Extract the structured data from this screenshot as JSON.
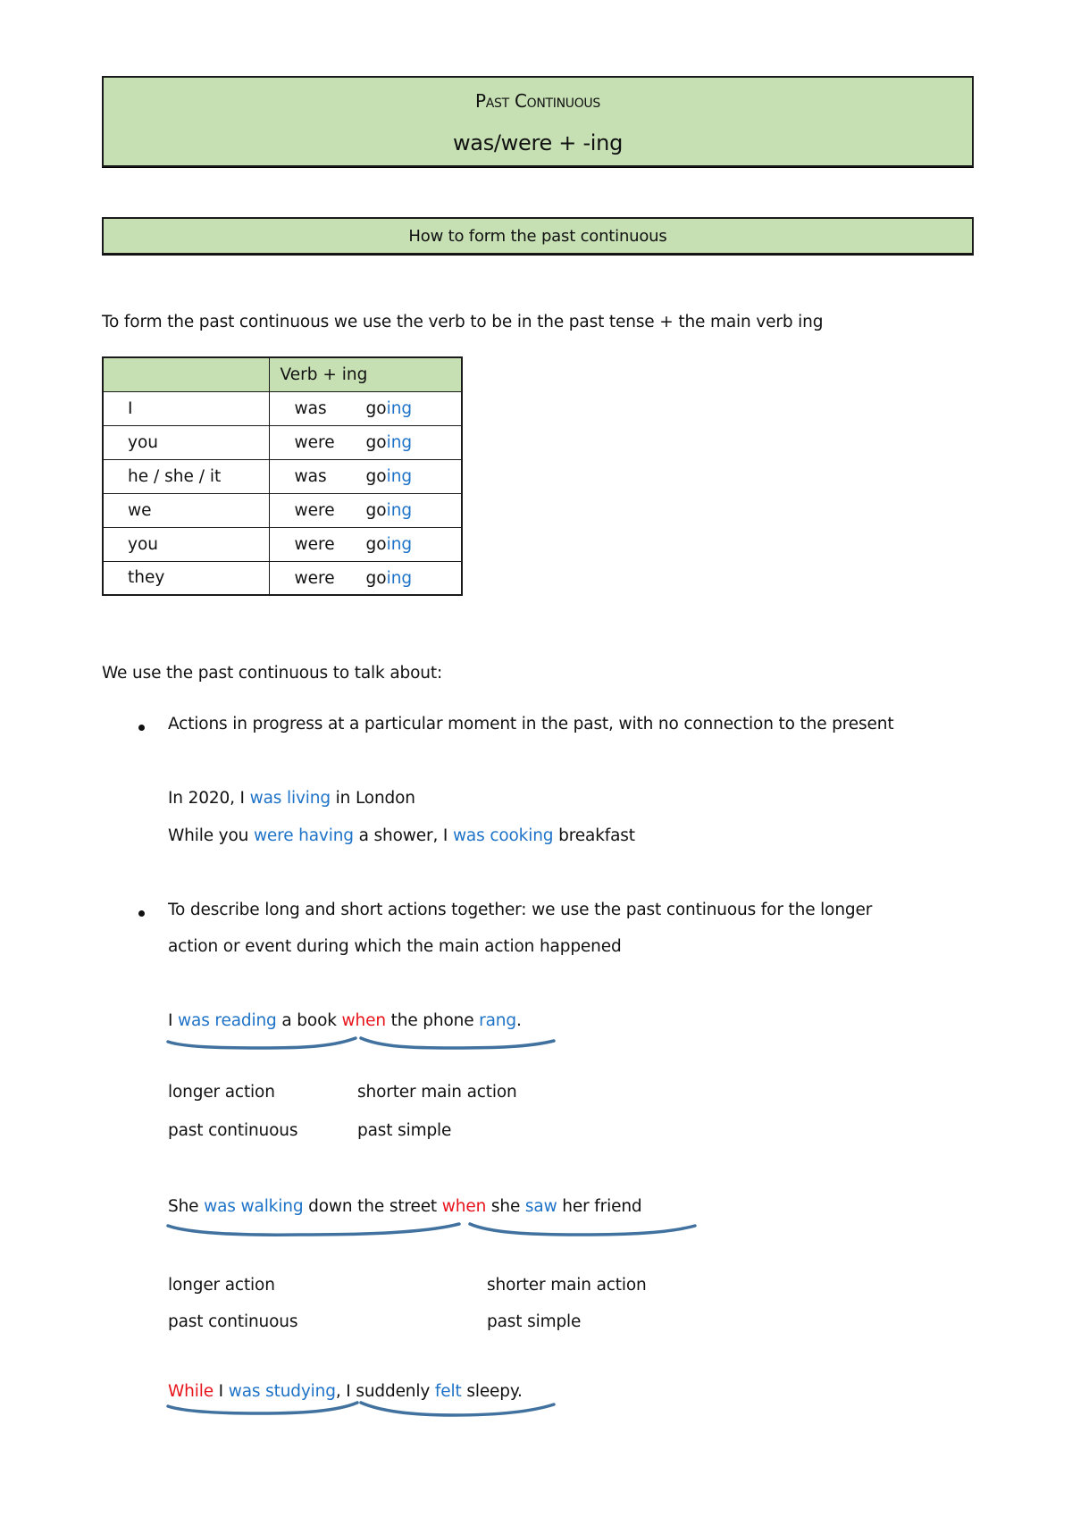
{
  "header": {
    "title": "Past Continuous",
    "formula": "was/were + -ing"
  },
  "section": {
    "title": "How to form the past continuous"
  },
  "intro": "To form the past continuous we use the verb to be in the past tense + the main verb ing",
  "table": {
    "header": [
      "",
      "Verb + ing"
    ],
    "rows": [
      {
        "pronoun": "I",
        "aux": "was",
        "stem": "go",
        "suffix": "ing"
      },
      {
        "pronoun": "you",
        "aux": "were",
        "stem": "go",
        "suffix": "ing"
      },
      {
        "pronoun": "he / she / it",
        "aux": "was",
        "stem": "go",
        "suffix": "ing"
      },
      {
        "pronoun": "we",
        "aux": "were",
        "stem": "go",
        "suffix": "ing"
      },
      {
        "pronoun": "you",
        "aux": "were",
        "stem": "go",
        "suffix": "ing"
      },
      {
        "pronoun": "they",
        "aux": "were",
        "stem": "go",
        "suffix": "ing"
      }
    ]
  },
  "uses_intro": "We use the past continuous to talk about:",
  "bullets": [
    {
      "text": "Actions in progress at a particular moment in the past, with no connection to the present"
    },
    {
      "line1": "To describe long and short actions together: we use the past continuous for the longer",
      "line2": "action or event during which the main action happened"
    }
  ],
  "examples1": {
    "ex1": [
      "In 2020, I ",
      "was living",
      " in London"
    ],
    "ex2": [
      "While you ",
      "were having",
      " a shower, I ",
      "was cooking",
      " breakfast"
    ]
  },
  "sentences": [
    {
      "parts": [
        "I ",
        "was reading",
        " a book ",
        "when",
        " the phone ",
        "rang",
        "."
      ],
      "label_left_1": "longer action",
      "label_left_2": "past continuous",
      "label_right_1": "shorter main action",
      "label_right_2": "past simple"
    },
    {
      "parts": [
        "She ",
        "was walking",
        " down the street ",
        "when",
        " she ",
        "saw",
        " her friend"
      ],
      "label_left_1": "longer action",
      "label_left_2": "past continuous",
      "label_right_1": "shorter main action",
      "label_right_2": "past simple"
    },
    {
      "parts": [
        "While",
        " I ",
        "was studying",
        ", I suddenly ",
        "felt",
        " sleepy."
      ]
    }
  ],
  "colors": {
    "box_fill": "#c6e0b4",
    "verb_blue": "#1e73c8",
    "connector_red": "#e8141c",
    "brace": "#41729f"
  }
}
